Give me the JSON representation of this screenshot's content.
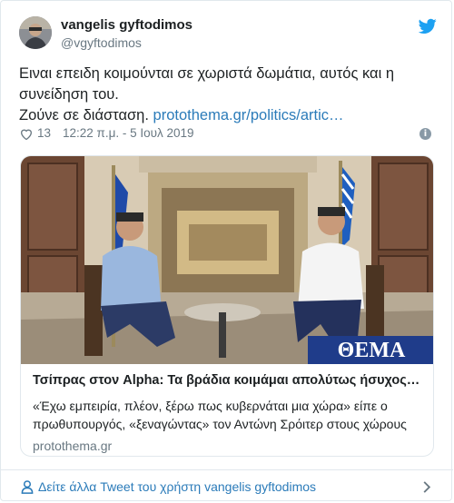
{
  "tweet": {
    "author_name": "vangelis gyftodimos",
    "author_handle": "@vgyftodimos",
    "text_line1": "Ειναι επειδη κοιμούνται σε χωριστά δωμάτια, αυτός και η",
    "text_line2": "συνείδηση του.",
    "text_line3_prefix": "Ζούνε σε διάσταση. ",
    "text_link": "protothema.gr/politics/artic…",
    "likes": "13",
    "timestamp": "12:22 π.μ. - 5 Ιουλ 2019",
    "icons": {
      "brand": "twitter-bird-icon",
      "like": "heart-icon",
      "info": "info-icon",
      "footer_user": "person-icon",
      "footer_arrow": "chevron-right-icon"
    }
  },
  "card": {
    "title": "Τσίπρας στον Alpha: Τα βράδια κοιμάμαι απολύτως ήσυχος μ…",
    "desc_line1": "«Έχω εμπειρία, πλέον, ξέρω πως κυβερνάται μια χώρα» είπε ο",
    "desc_line2": "πρωθυπουργός, «ξεναγώντας» τον Αντώνη Σρόιτερ στους χώρους",
    "domain": "protothema.gr",
    "image_watermark": "ΘΕΜΑ"
  },
  "footer": {
    "more_text": "Δείτε άλλα Tweet του χρήστη vangelis gyftodimos"
  },
  "colors": {
    "link": "#2b7bb9",
    "secondary_text": "#697882",
    "border": "#e1e8ed",
    "twitter_blue": "#1da1f2",
    "watermark_bg": "#1f3c8a"
  }
}
